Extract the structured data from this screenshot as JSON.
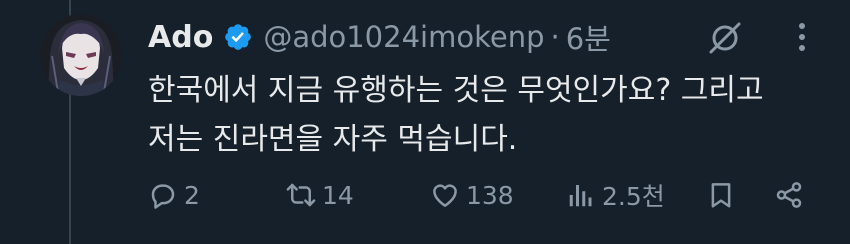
{
  "tweet": {
    "author": {
      "display_name": "Ado",
      "handle": "@ado1024imokenp",
      "verified": true,
      "separator": "·",
      "timestamp": "6분"
    },
    "text_lines": [
      "한국에서 지금 유행하는 것은 무엇인가요? 그리고",
      "저는 진라면을 자주 먹습니다."
    ],
    "actions": {
      "replies": "2",
      "retweets": "14",
      "likes": "138",
      "views": "2.5천"
    }
  },
  "icons": {
    "verified": "verified-badge-icon",
    "grok": "grok-icon",
    "more": "more-vertical-icon",
    "reply": "reply-icon",
    "retweet": "retweet-icon",
    "like": "heart-icon",
    "views": "views-icon",
    "bookmark": "bookmark-icon",
    "share": "share-icon"
  },
  "colors": {
    "background": "#15202b",
    "text_primary": "#e7e9ea",
    "text_secondary": "#8b98a5",
    "verified_blue": "#1d9bf0",
    "thread_line": "#38444d"
  }
}
